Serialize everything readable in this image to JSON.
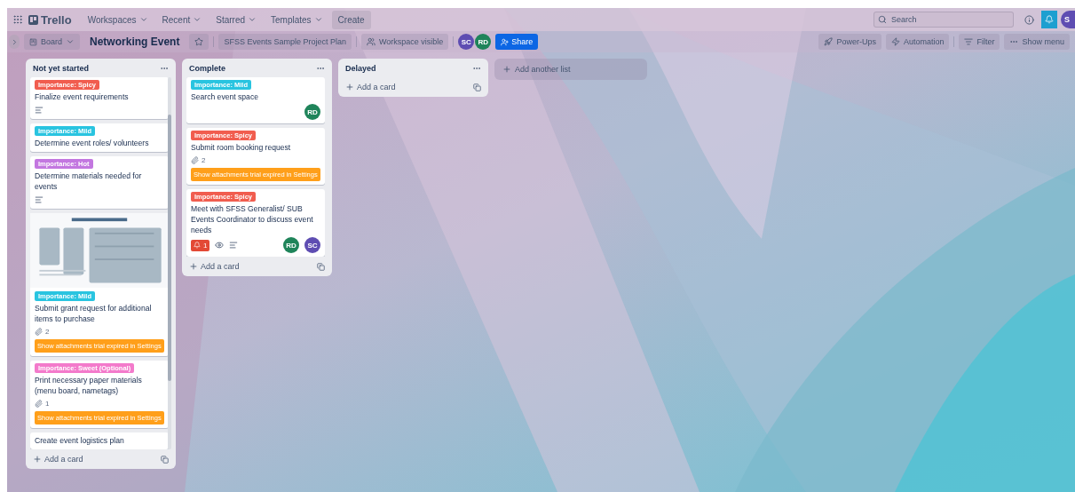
{
  "nav": {
    "logo": "Trello",
    "menus": [
      {
        "label": "Workspaces"
      },
      {
        "label": "Recent"
      },
      {
        "label": "Starred"
      },
      {
        "label": "Templates"
      }
    ],
    "create": "Create",
    "search": {
      "placeholder": "Search"
    },
    "user_initial": "S"
  },
  "board_bar": {
    "view": "Board",
    "title": "Networking Event",
    "starred": false,
    "workspace": "SFSS Events Sample Project Plan",
    "visibility": "Workspace visible",
    "members": [
      {
        "initials": "SC",
        "color": "#5e4db2"
      },
      {
        "initials": "RD",
        "color": "#1f845a"
      }
    ],
    "share": "Share",
    "actions": [
      {
        "kind": "powerups",
        "label": "Power-Ups"
      },
      {
        "kind": "automation",
        "label": "Automation"
      },
      {
        "kind": "filter",
        "label": "Filter"
      },
      {
        "kind": "menu",
        "label": "Show menu"
      }
    ]
  },
  "lists": [
    {
      "title": "Not yet started",
      "add_card": "Add a card",
      "cards": [
        {
          "label": {
            "text": "Importance: Spicy",
            "color": "#f15d4f"
          },
          "title": "Finalize event requirements",
          "description": true
        },
        {
          "label": {
            "text": "Importance: Mild",
            "color": "#29c4e0"
          },
          "title": "Determine event roles/ volunteers",
          "description": false
        },
        {
          "label": {
            "text": "Importance: Hot",
            "color": "#c377e0"
          },
          "title": "Determine materials needed for events",
          "description": true
        },
        {
          "label": {
            "text": "Importance: Mild",
            "color": "#29c4e0"
          },
          "title": "Submit grant request for additional items to purchase",
          "description": false,
          "attachments": "2",
          "notice": "Show attachments trial expired in Settings"
        },
        {
          "label": {
            "text": "Importance: Sweet (Optional)",
            "color": "#f37acb"
          },
          "title": "Print necessary paper materials (menu board, nametags)",
          "description": false,
          "attachments": "1",
          "notice": "Show attachments trial expired in Settings"
        },
        {
          "title": "Create event logistics plan",
          "description": false
        }
      ]
    },
    {
      "title": "Complete",
      "add_card": "Add a card",
      "cards": [
        {
          "label": {
            "text": "Importance: Mild",
            "color": "#29c4e0"
          },
          "title": "Search event space",
          "description": false,
          "members": [
            {
              "initials": "RD",
              "color": "#1f845a"
            }
          ]
        },
        {
          "label": {
            "text": "Importance: Spicy",
            "color": "#f15d4f"
          },
          "title": "Submit room booking request",
          "description": false,
          "attachments": "2",
          "notice": "Show attachments trial expired in Settings"
        },
        {
          "label": {
            "text": "Importance: Spicy",
            "color": "#f15d4f"
          },
          "title": "Meet with SFSS Generalist/ SUB Events Coordinator to discuss event needs",
          "description": true,
          "alerts": "1",
          "watching": true,
          "members": [
            {
              "initials": "RD",
              "color": "#1f845a"
            },
            {
              "initials": "SC",
              "color": "#5e4db2"
            }
          ]
        }
      ]
    },
    {
      "title": "Delayed",
      "add_card": "Add a card"
    }
  ],
  "add_list": "Add another list"
}
